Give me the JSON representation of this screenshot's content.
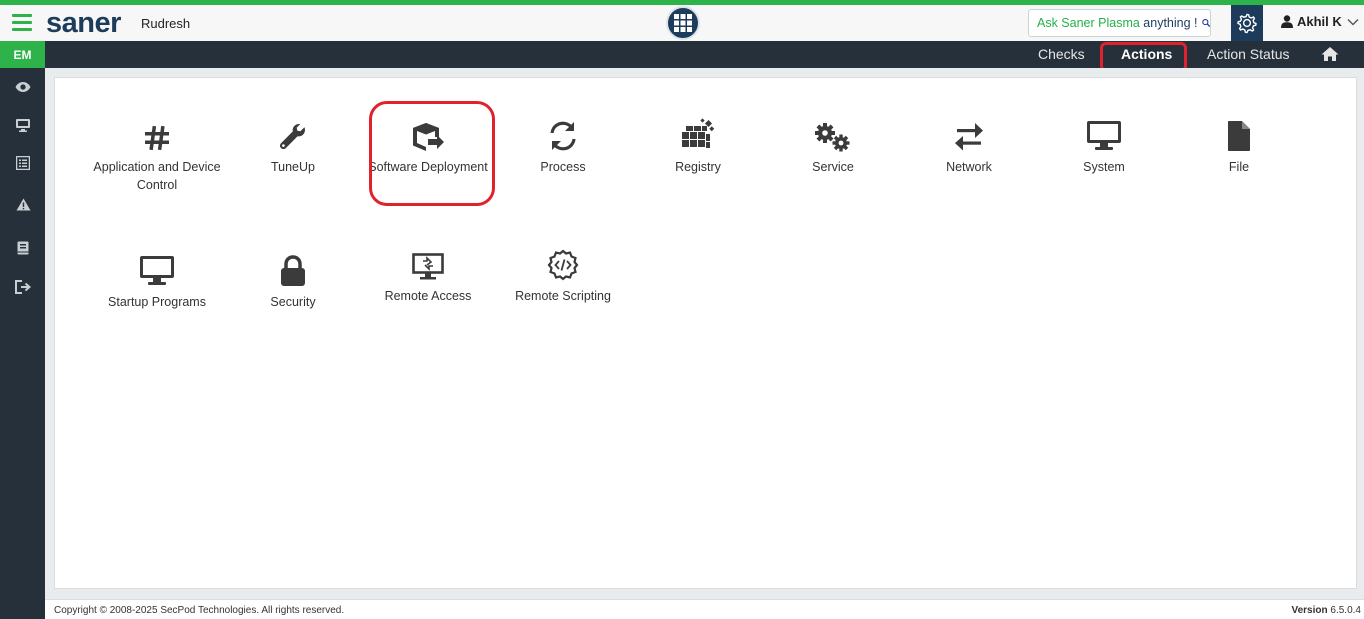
{
  "header": {
    "logo": "saner",
    "tenant": "Rudresh",
    "ask_prefix": "Ask Saner Plasma ",
    "ask_suffix": "anything !",
    "user": "Akhil K"
  },
  "navbar": {
    "badge": "EM",
    "tabs": [
      {
        "label": "Checks"
      },
      {
        "label": "Actions",
        "active": true
      },
      {
        "label": "Action Status"
      }
    ]
  },
  "actions": [
    {
      "label": "Application and Device Control",
      "icon": "hash-icon"
    },
    {
      "label": "TuneUp",
      "icon": "wrench-icon"
    },
    {
      "label": "Software Deployment",
      "icon": "package-icon"
    },
    {
      "label": "Process",
      "icon": "sync-icon"
    },
    {
      "label": "Registry",
      "icon": "cubes-icon"
    },
    {
      "label": "Service",
      "icon": "cogs-icon"
    },
    {
      "label": "Network",
      "icon": "exchange-icon"
    },
    {
      "label": "System",
      "icon": "monitor-icon"
    },
    {
      "label": "File",
      "icon": "file-icon"
    },
    {
      "label": "Startup Programs",
      "icon": "desktop-icon"
    },
    {
      "label": "Security",
      "icon": "lock-icon"
    },
    {
      "label": "Remote Access",
      "icon": "remote-desktop-icon"
    },
    {
      "label": "Remote Scripting",
      "icon": "code-gear-icon"
    }
  ],
  "footer": {
    "copyright": "Copyright © 2008-2025 SecPod Technologies. All rights reserved.",
    "version_label": "Version",
    "version": "6.5.0.4"
  },
  "colors": {
    "brand_green": "#2db34a",
    "brand_navy": "#1d3b5a",
    "nav_dark": "#25303a",
    "highlight_red": "#e0222c"
  }
}
